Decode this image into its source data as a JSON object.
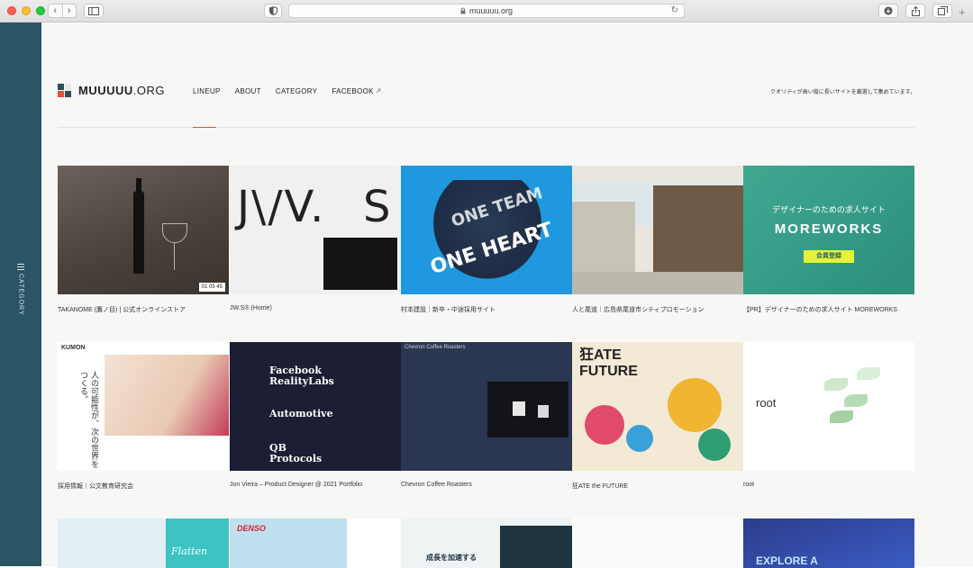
{
  "browser": {
    "url": "muuuuu.org",
    "nav_back": "‹",
    "nav_forward": "›",
    "reload_icon": "↻",
    "newtab_icon": "+"
  },
  "sidebar": {
    "label": "CATEGORY"
  },
  "header": {
    "logo_bold": "MUUUUU",
    "logo_light": ".ORG",
    "nav": [
      {
        "label": "LINEUP"
      },
      {
        "label": "ABOUT"
      },
      {
        "label": "CATEGORY"
      },
      {
        "label": "FACEBOOK"
      }
    ],
    "tagline": "クオリティが高い縦に長いサイトを厳選して集めています。"
  },
  "colors": {
    "accent": "#e0532f",
    "sidebar": "#2b5566"
  },
  "cards": [
    {
      "caption": "TAKANOME (鷹ノ目) | 公式オンラインストア",
      "timer": "01  05  45"
    },
    {
      "caption": "JW.S® (Home)",
      "big_left": "J\\/V.",
      "big_right": "S"
    },
    {
      "caption": "村本建設｜新卒・中途採用サイト",
      "art_1": "ONE TEAM",
      "art_2": "ONE HEART"
    },
    {
      "caption": "人と尾道｜広島県尾道市シティプロモーション"
    },
    {
      "caption": "【PR】デザイナーのための求人サイト MOREWORKS",
      "title": "デザイナーのための求人サイト",
      "brand": "MOREWORKS",
      "cta": "会員登録"
    },
    {
      "caption": "採用情報｜公文教育研究会",
      "logo": "KUMON",
      "text": "人の可能性が、次の世界をつくる。"
    },
    {
      "caption": "Jon Vieira – Product Designer @ 2021 Portfolio",
      "lines": [
        "Facebook",
        "RealityLabs",
        "Automotive",
        "QB",
        "Protocols"
      ]
    },
    {
      "caption": "Chevron Coffee Roasters",
      "head": "Chevron Coffee Roasters"
    },
    {
      "caption": "狂ATE the FUTURE",
      "head": "狂ATE FUTURE"
    },
    {
      "caption": "root",
      "word": "root"
    }
  ],
  "row3": [
    {
      "art": "Flatten"
    },
    {
      "art": "DENSO"
    },
    {
      "art": "成長を加速する"
    },
    {
      "art": ""
    },
    {
      "art": "EXPLORE A"
    }
  ]
}
